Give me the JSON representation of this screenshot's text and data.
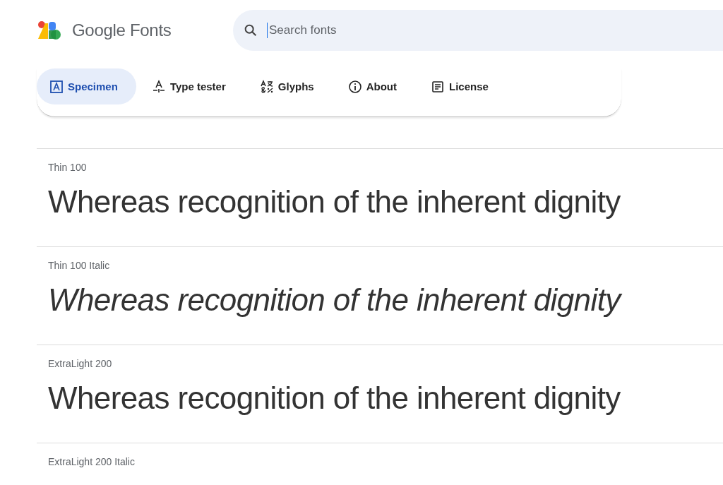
{
  "header": {
    "logo_text": "Google Fonts",
    "search": {
      "placeholder": "Search fonts"
    }
  },
  "tabs": [
    {
      "label": "Specimen",
      "kind": "specimen",
      "selected": true
    },
    {
      "label": "Type tester",
      "kind": "tester",
      "selected": false
    },
    {
      "label": "Glyphs",
      "kind": "glyphs",
      "selected": false
    },
    {
      "label": "About",
      "kind": "about",
      "selected": false
    },
    {
      "label": "License",
      "kind": "license",
      "selected": false
    }
  ],
  "styles": [
    {
      "label": "Thin 100",
      "italic": false,
      "sample": "Whereas recognition of the inherent dignity"
    },
    {
      "label": "Thin 100 Italic",
      "italic": true,
      "sample": "Whereas recognition of the inherent dignity"
    },
    {
      "label": "ExtraLight 200",
      "italic": false,
      "sample": "Whereas recognition of the inherent dignity"
    },
    {
      "label": "ExtraLight 200 Italic"
    }
  ]
}
